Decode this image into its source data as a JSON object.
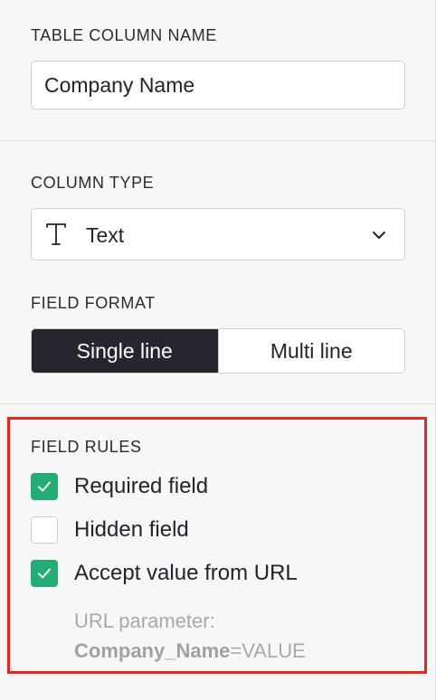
{
  "column_name": {
    "label": "TABLE COLUMN NAME",
    "value": "Company Name"
  },
  "column_type": {
    "label": "COLUMN TYPE",
    "selected": "Text",
    "icon": "text-type-icon"
  },
  "field_format": {
    "label": "FIELD FORMAT",
    "options": [
      "Single line",
      "Multi line"
    ],
    "selected": "Single line"
  },
  "field_rules": {
    "label": "FIELD RULES",
    "rules": [
      {
        "label": "Required field",
        "checked": true
      },
      {
        "label": "Hidden field",
        "checked": false
      },
      {
        "label": "Accept value from URL",
        "checked": true
      }
    ],
    "url_hint": {
      "prefix": "URL parameter:",
      "param": "Company_Name",
      "suffix": "=VALUE"
    }
  },
  "colors": {
    "accent_green": "#21ad73",
    "dark_segment": "#26262e",
    "highlight_red": "#e8261c",
    "background": "#f7f7f7"
  }
}
